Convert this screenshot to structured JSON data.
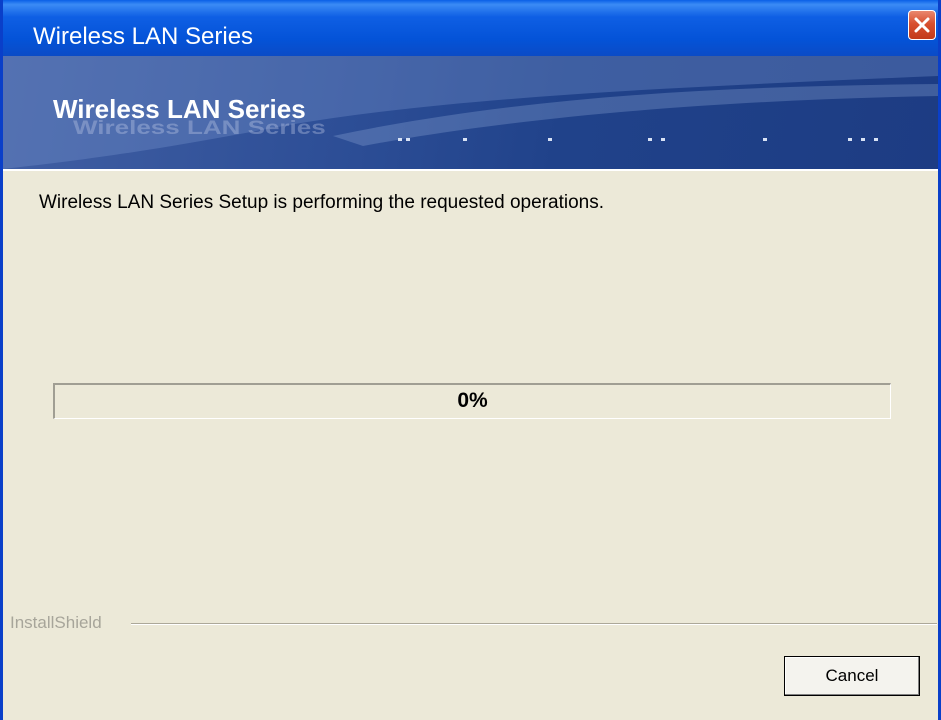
{
  "window": {
    "title": "Wireless LAN Series"
  },
  "banner": {
    "logo_text": "Wireless LAN Series"
  },
  "main": {
    "message": "Wireless LAN Series Setup is performing the requested operations."
  },
  "progress": {
    "label": "0%",
    "value_percent": 0
  },
  "footer": {
    "brand": "InstallShield",
    "cancel_label": "Cancel"
  },
  "colors": {
    "titlebar": "#0453d8",
    "banner": "#2e4f97",
    "dialog_background": "#ece9d8",
    "close_button": "#d8502f",
    "progress_fill": "#316ac5"
  },
  "icons": {
    "close": "close-icon"
  }
}
